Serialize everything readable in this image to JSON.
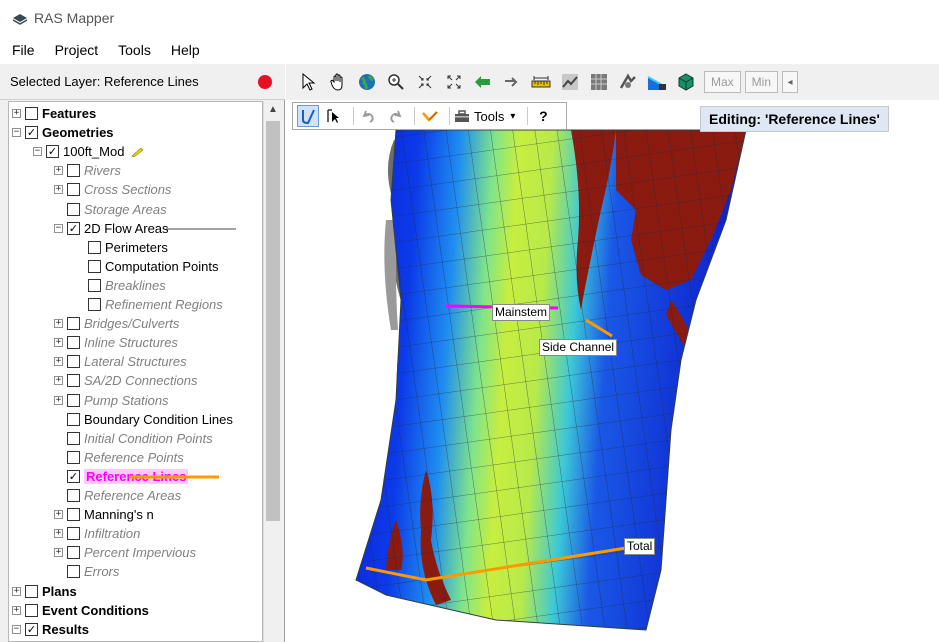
{
  "app": {
    "title": "RAS Mapper"
  },
  "menu": [
    "File",
    "Project",
    "Tools",
    "Help"
  ],
  "layer_header": {
    "label": "Selected Layer: Reference Lines"
  },
  "tree": [
    {
      "label": "Features",
      "style": "bold",
      "expander": "+",
      "checked": false
    },
    {
      "label": "Geometries",
      "style": "bold",
      "expander": "-",
      "checked": true
    },
    {
      "label": "100ft_Mod",
      "style": "normal",
      "expander": "-",
      "checked": true
    },
    {
      "label": "Rivers",
      "style": "gray",
      "expander": "+",
      "checked": false
    },
    {
      "label": "Cross Sections",
      "style": "gray",
      "expander": "+",
      "checked": false
    },
    {
      "label": "Storage Areas",
      "style": "gray",
      "expander": "",
      "checked": false
    },
    {
      "label": "2D Flow Areas",
      "style": "normal",
      "expander": "-",
      "checked": true
    },
    {
      "label": "Perimeters",
      "style": "normal",
      "expander": "",
      "checked": false
    },
    {
      "label": "Computation Points",
      "style": "normal",
      "expander": "",
      "checked": false
    },
    {
      "label": "Breaklines",
      "style": "gray",
      "expander": "",
      "checked": false
    },
    {
      "label": "Refinement Regions",
      "style": "gray",
      "expander": "",
      "checked": false
    },
    {
      "label": "Bridges/Culverts",
      "style": "gray",
      "expander": "+",
      "checked": false
    },
    {
      "label": "Inline Structures",
      "style": "gray",
      "expander": "+",
      "checked": false
    },
    {
      "label": "Lateral Structures",
      "style": "gray",
      "expander": "+",
      "checked": false
    },
    {
      "label": "SA/2D Connections",
      "style": "gray",
      "expander": "+",
      "checked": false
    },
    {
      "label": "Pump Stations",
      "style": "gray",
      "expander": "+",
      "checked": false
    },
    {
      "label": "Boundary Condition Lines",
      "style": "normal",
      "expander": "",
      "checked": false
    },
    {
      "label": "Initial Condition Points",
      "style": "gray",
      "expander": "",
      "checked": false
    },
    {
      "label": "Reference Points",
      "style": "gray",
      "expander": "",
      "checked": false
    },
    {
      "label": "Reference Lines",
      "style": "highlight",
      "expander": "",
      "checked": true
    },
    {
      "label": "Reference Areas",
      "style": "gray",
      "expander": "",
      "checked": false
    },
    {
      "label": "Manning's n",
      "style": "normal",
      "expander": "+",
      "checked": false
    },
    {
      "label": "Infiltration",
      "style": "gray",
      "expander": "+",
      "checked": false
    },
    {
      "label": "Percent Impervious",
      "style": "gray",
      "expander": "+",
      "checked": false
    },
    {
      "label": "Errors",
      "style": "gray",
      "expander": "",
      "checked": false
    },
    {
      "label": "Plans",
      "style": "bold",
      "expander": "+",
      "checked": false
    },
    {
      "label": "Event Conditions",
      "style": "bold",
      "expander": "+",
      "checked": false
    },
    {
      "label": "Results",
      "style": "bold",
      "expander": "-",
      "checked": true
    }
  ],
  "toolbar": {
    "max_label": "Max",
    "min_label": "Min",
    "arrow_label": "◂"
  },
  "map_tools": {
    "tools_label": "Tools",
    "help_label": "?",
    "tools_dropdown": "▾"
  },
  "editing": {
    "label": "Editing: 'Reference Lines'"
  },
  "map_labels": {
    "mainstem": "Mainstem",
    "side_channel": "Side Channel",
    "total": "Total"
  },
  "colors": {
    "reference_line_mainstem": "#ff00ff",
    "reference_line_other": "#ff9900",
    "record_dot": "#e81123",
    "terrain_red": "#8b1a10",
    "water_deep": "#0a1ad8",
    "water_mid": "#2aa6f0",
    "water_shallow": "#c8ee40"
  }
}
